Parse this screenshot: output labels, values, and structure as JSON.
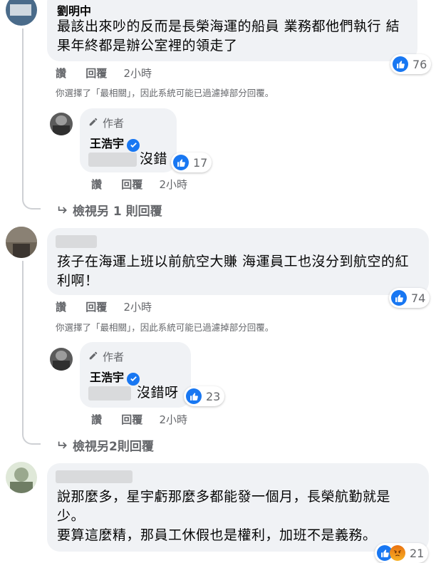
{
  "comments": [
    {
      "author": "劉明中",
      "text_lines": [
        "最該出來吵的反而是長榮海運的船員 業務都他們執行 結",
        "果年終都是辦公室裡的領走了"
      ],
      "reaction_count": "76",
      "actions": {
        "like": "讚",
        "reply": "回覆",
        "time": "2小時"
      },
      "filter_note": "你選擇了「最相關」，因此系統可能已過濾掉部分回覆。",
      "reply": {
        "author_badge": "作者",
        "author": "王浩宇",
        "text": "沒錯",
        "reaction_count": "17",
        "actions": {
          "like": "讚",
          "reply": "回覆",
          "time": "2小時"
        }
      },
      "view_more": "檢視另 1 則回覆"
    },
    {
      "author": "",
      "text_lines": [
        "孩子在海運上班以前航空大賺 海運員工也沒分到航空的紅",
        "利啊！"
      ],
      "reaction_count": "74",
      "actions": {
        "like": "讚",
        "reply": "回覆",
        "time": "2小時"
      },
      "filter_note": "你選擇了「最相關」，因此系統可能已過濾掉部分回覆。",
      "reply": {
        "author_badge": "作者",
        "author": "王浩宇",
        "text": "沒錯呀",
        "reaction_count": "23",
        "actions": {
          "like": "讚",
          "reply": "回覆",
          "time": "2小時"
        }
      },
      "view_more": "檢視另2則回覆"
    },
    {
      "author": "",
      "text_lines": [
        "說那麼多，星宇虧那麼多都能發一個月，長榮航勤就是",
        "少。",
        "要算這麼精，那員工休假也是權利，加班不是義務。"
      ],
      "reaction_count": "21"
    }
  ],
  "icons": {
    "like": "like-icon",
    "angry": "angry-icon",
    "verified": "verified-badge-icon",
    "reply_arrow": "reply-arrow-icon",
    "author": "author-pen-icon"
  },
  "colors": {
    "accent": "#1877f2",
    "bubble": "#f0f2f5",
    "secondary_text": "#65676b"
  }
}
